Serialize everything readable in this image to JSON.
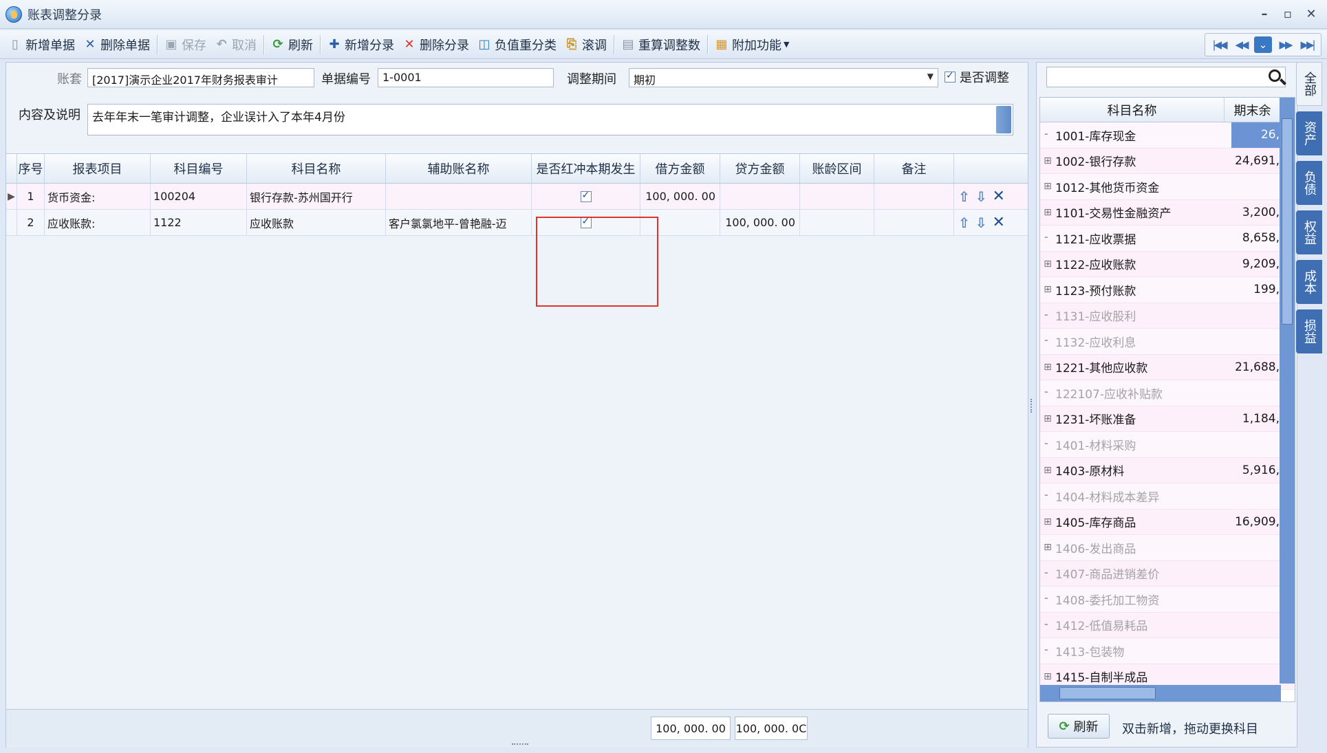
{
  "window": {
    "title": "账表调整分录",
    "controls": {
      "minimize": "–",
      "maximize": "▫",
      "close": "✕"
    }
  },
  "toolbar": {
    "buttons": [
      {
        "label": "新增单据",
        "icon": "new-doc-icon",
        "enabled": true
      },
      {
        "label": "删除单据",
        "icon": "delete-icon",
        "enabled": true
      },
      {
        "label": "保存",
        "icon": "save-icon",
        "enabled": false
      },
      {
        "label": "取消",
        "icon": "undo-icon",
        "enabled": false
      },
      {
        "label": "刷新",
        "icon": "refresh-icon",
        "enabled": true
      },
      {
        "label": "新增分录",
        "icon": "plus-icon",
        "enabled": true
      },
      {
        "label": "删除分录",
        "icon": "delete-red-icon",
        "enabled": true
      },
      {
        "label": "负值重分类",
        "icon": "reclassify-icon",
        "enabled": true
      },
      {
        "label": "滚调",
        "icon": "rollover-icon",
        "enabled": true
      },
      {
        "label": "重算调整数",
        "icon": "recalc-icon",
        "enabled": true
      },
      {
        "label": "附加功能",
        "icon": "addon-icon",
        "enabled": true,
        "dropdown": true
      }
    ]
  },
  "form": {
    "ledger_label": "账套",
    "ledger_value": "[2017]演示企业2017年财务报表审计",
    "doc_no_label": "单据编号",
    "doc_no_value": "1-0001",
    "period_label": "调整期间",
    "period_value": "期初",
    "adjust_label": "是否调整",
    "adjust_checked": true,
    "desc_label": "内容及说明",
    "desc_value": "去年年末一笔审计调整，企业误计入了本年4月份"
  },
  "grid": {
    "headers": [
      "序号",
      "报表项目",
      "科目编号",
      "科目名称",
      "辅助账名称",
      "是否红冲本期发生",
      "借方金额",
      "贷方金额",
      "账龄区间",
      "备注"
    ],
    "rows": [
      {
        "seq": "1",
        "item": "货币资金:",
        "code": "100204",
        "name": "银行存款-苏州国开行",
        "aux": "",
        "reverse": true,
        "debit": "100, 000. 00",
        "credit": "",
        "aging": "",
        "note": ""
      },
      {
        "seq": "2",
        "item": "应收账款:",
        "code": "1122",
        "name": "应收账款",
        "aux": "客户氯氯地平-曾艳融-迈",
        "reverse": true,
        "debit": "",
        "credit": "100, 000. 00",
        "aging": "",
        "note": ""
      }
    ],
    "totals": {
      "debit": "100, 000. 00",
      "credit": "100, 000. 0C"
    }
  },
  "account_tree": {
    "search_placeholder": "",
    "headers": [
      "科目名称",
      "期末余"
    ],
    "rows": [
      {
        "name": "1001-库存现金",
        "value": "26,",
        "expandable": false,
        "dim": false,
        "selected": true
      },
      {
        "name": "1002-银行存款",
        "value": "24,691,",
        "expandable": true,
        "dim": false
      },
      {
        "name": "1012-其他货币资金",
        "value": "",
        "expandable": true,
        "dim": false
      },
      {
        "name": "1101-交易性金融资产",
        "value": "3,200,",
        "expandable": true,
        "dim": false
      },
      {
        "name": "1121-应收票据",
        "value": "8,658,",
        "expandable": false,
        "dim": false
      },
      {
        "name": "1122-应收账款",
        "value": "9,209,",
        "expandable": true,
        "dim": false
      },
      {
        "name": "1123-预付账款",
        "value": "199,",
        "expandable": true,
        "dim": false
      },
      {
        "name": "1131-应收股利",
        "value": "",
        "expandable": false,
        "dim": true
      },
      {
        "name": "1132-应收利息",
        "value": "",
        "expandable": false,
        "dim": true
      },
      {
        "name": "1221-其他应收款",
        "value": "21,688,",
        "expandable": true,
        "dim": false
      },
      {
        "name": "122107-应收补贴款",
        "value": "",
        "expandable": false,
        "dim": true
      },
      {
        "name": "1231-坏账准备",
        "value": "1,184,",
        "expandable": true,
        "dim": false
      },
      {
        "name": "1401-材料采购",
        "value": "",
        "expandable": false,
        "dim": true
      },
      {
        "name": "1403-原材料",
        "value": "5,916,",
        "expandable": true,
        "dim": false
      },
      {
        "name": "1404-材料成本差异",
        "value": "",
        "expandable": false,
        "dim": true
      },
      {
        "name": "1405-库存商品",
        "value": "16,909,",
        "expandable": true,
        "dim": false
      },
      {
        "name": "1406-发出商品",
        "value": "",
        "expandable": true,
        "dim": true
      },
      {
        "name": "1407-商品进销差价",
        "value": "",
        "expandable": false,
        "dim": true
      },
      {
        "name": "1408-委托加工物资",
        "value": "",
        "expandable": false,
        "dim": true
      },
      {
        "name": "1412-低值易耗品",
        "value": "",
        "expandable": false,
        "dim": true
      },
      {
        "name": "1413-包装物",
        "value": "",
        "expandable": false,
        "dim": true
      },
      {
        "name": "1415-自制半成品",
        "value": "",
        "expandable": true,
        "dim": false
      }
    ],
    "refresh_label": "刷新",
    "hint": "双击新增，拖动更换科目"
  },
  "side_tabs": [
    "全部",
    "资产",
    "负债",
    "权益",
    "成本",
    "损益"
  ],
  "colors": {
    "accent": "#3f6fb2",
    "highlight_box": "#e0322c",
    "row_pink": "#fbf2fb"
  }
}
